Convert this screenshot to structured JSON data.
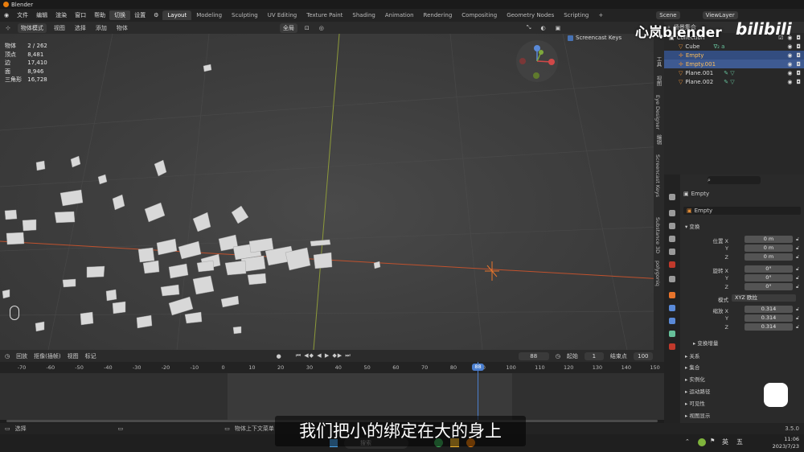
{
  "window": {
    "title": "Blender"
  },
  "menu": {
    "items": [
      "文件",
      "编辑",
      "渲染",
      "窗口",
      "帮助"
    ],
    "highlight": "切换",
    "settings": "设置"
  },
  "workspaces": [
    "Layout",
    "Modeling",
    "Sculpting",
    "UV Editing",
    "Texture Paint",
    "Shading",
    "Animation",
    "Rendering",
    "Compositing",
    "Geometry Nodes",
    "Scripting"
  ],
  "active_workspace": "Layout",
  "add_tab": "+",
  "scene": {
    "label": "Scene",
    "view_layer": "ViewLayer"
  },
  "viewport_header": {
    "mode": "物体模式",
    "view": "视图",
    "select": "选择",
    "add": "添加",
    "object": "物体",
    "orientation": "全局"
  },
  "stats": [
    {
      "label": "物体",
      "value": "2 / 262"
    },
    {
      "label": "顶点",
      "value": "8,481"
    },
    {
      "label": "边",
      "value": "17,410"
    },
    {
      "label": "面",
      "value": "8,946"
    },
    {
      "label": "三角形",
      "value": "16,728"
    }
  ],
  "screencast_keys": {
    "label": "Screencast Keys",
    "checked": true
  },
  "vertical_tabs": [
    "工具",
    "视图",
    "Eye Designer",
    "编辑",
    "Screencast Keys",
    "Substance 3D",
    "polygoniq"
  ],
  "outliner": {
    "scene_collection": "场景集合",
    "rows": [
      {
        "name": "Collection",
        "indent": 0,
        "state": "normal"
      },
      {
        "name": "Cube",
        "indent": 1,
        "state": "normal",
        "extra": "∇₂ a"
      },
      {
        "name": "Empty",
        "indent": 1,
        "state": "selected"
      },
      {
        "name": "Empty.001",
        "indent": 1,
        "state": "active"
      },
      {
        "name": "Plane.001",
        "indent": 1,
        "state": "normal"
      },
      {
        "name": "Plane.002",
        "indent": 1,
        "state": "normal"
      }
    ]
  },
  "properties": {
    "object_name": "Empty",
    "object_field": "Empty",
    "transform_label": "变换",
    "location_label": "位置",
    "rotation_label": "旋转",
    "scale_label": "缩放",
    "mode_label": "模式",
    "mode_value": "XYZ 欧拉",
    "location": [
      "0 m",
      "0 m",
      "0 m"
    ],
    "rotation": [
      "0°",
      "0°",
      "0°"
    ],
    "scale": [
      "0.314",
      "0.314",
      "0.314"
    ],
    "axes": [
      "X",
      "Y",
      "Z"
    ],
    "delta_label": "变换增量",
    "sections": [
      "关系",
      "集合",
      "实例化",
      "运动路径",
      "可见性",
      "视图显示"
    ]
  },
  "timeline": {
    "menu": [
      "回放",
      "抠像(插帧)",
      "视图",
      "标记"
    ],
    "current_frame": "88",
    "start_label": "起始",
    "start": "1",
    "end_label": "结束点",
    "end": "100",
    "ticks": [
      "-70",
      "-60",
      "-50",
      "-40",
      "-30",
      "-20",
      "-10",
      "0",
      "10",
      "20",
      "30",
      "40",
      "50",
      "60",
      "70",
      "80",
      "90",
      "100",
      "110",
      "120",
      "130",
      "140",
      "150"
    ],
    "playhead_label": "88"
  },
  "status": {
    "left": "选择",
    "middle": "物体上下文菜单",
    "version": "3.5.0"
  },
  "taskbar": {
    "search": "搜索",
    "ime1": "英",
    "ime2": "五",
    "time": "11:06",
    "date": "2023/7/23"
  },
  "subtitle": "我们把小的绑定在大的身上",
  "watermark": "心岚blender",
  "watermark_bili": "bilibili",
  "colors": {
    "accent": "#4772b3",
    "active_text": "#ffbf5a",
    "playhead": "#4b7fcf",
    "empty_orange": "#e8742b"
  }
}
